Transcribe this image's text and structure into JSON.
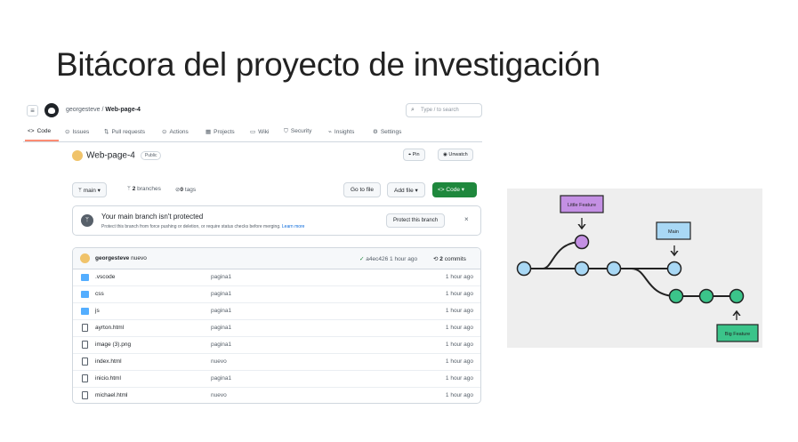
{
  "slide": {
    "title": "Bitácora del proyecto de investigación"
  },
  "header": {
    "owner": "georgesteve",
    "separator": "/",
    "repo": "Web-page-4",
    "search_placeholder": "Type / to search"
  },
  "tabs": [
    {
      "label": "Code",
      "icon": "code-icon"
    },
    {
      "label": "Issues",
      "icon": "issues-icon"
    },
    {
      "label": "Pull requests",
      "icon": "pull-request-icon"
    },
    {
      "label": "Actions",
      "icon": "actions-icon"
    },
    {
      "label": "Projects",
      "icon": "projects-icon"
    },
    {
      "label": "Wiki",
      "icon": "wiki-icon"
    },
    {
      "label": "Security",
      "icon": "shield-icon"
    },
    {
      "label": "Insights",
      "icon": "graph-icon"
    },
    {
      "label": "Settings",
      "icon": "gear-icon"
    }
  ],
  "repo": {
    "name": "Web-page-4",
    "visibility": "Public",
    "pin_label": "Pin",
    "unwatch_label": "Unwatch"
  },
  "branch_bar": {
    "branch": "main",
    "branches_count": "2",
    "branches_label": "branches",
    "tags_count": "0",
    "tags_label": "tags",
    "go_to_file": "Go to file",
    "add_file": "Add file",
    "code_label": "Code"
  },
  "protection": {
    "title": "Your main branch isn't protected",
    "subtitle": "Protect this branch from force pushing or deletion, or require status checks before merging.",
    "learn_more": "Learn more",
    "button": "Protect this branch",
    "close": "×"
  },
  "last_commit": {
    "author": "georgesteve",
    "message": "nuevo",
    "hash": "a4ec426",
    "time": "1 hour ago",
    "commits_count": "2",
    "commits_label": "commits"
  },
  "files": [
    {
      "name": ".vscode",
      "type": "folder",
      "message": "pagina1",
      "time": "1 hour ago"
    },
    {
      "name": "css",
      "type": "folder",
      "message": "pagina1",
      "time": "1 hour ago"
    },
    {
      "name": "js",
      "type": "folder",
      "message": "pagina1",
      "time": "1 hour ago"
    },
    {
      "name": "ayrton.html",
      "type": "file",
      "message": "pagina1",
      "time": "1 hour ago"
    },
    {
      "name": "image (3).png",
      "type": "file",
      "message": "pagina1",
      "time": "1 hour ago"
    },
    {
      "name": "index.html",
      "type": "file",
      "message": "nuevo",
      "time": "1 hour ago"
    },
    {
      "name": "inicio.html",
      "type": "file",
      "message": "pagina1",
      "time": "1 hour ago"
    },
    {
      "name": "michael.html",
      "type": "file",
      "message": "nuevo",
      "time": "1 hour ago"
    }
  ],
  "diagram": {
    "little_feature": "Little Feature",
    "main": "Main",
    "big_feature": "Big Feature",
    "colors": {
      "main_node": "#a9d8f5",
      "little_node": "#c490e4",
      "big_node": "#3bc48a",
      "line": "#222222"
    }
  }
}
